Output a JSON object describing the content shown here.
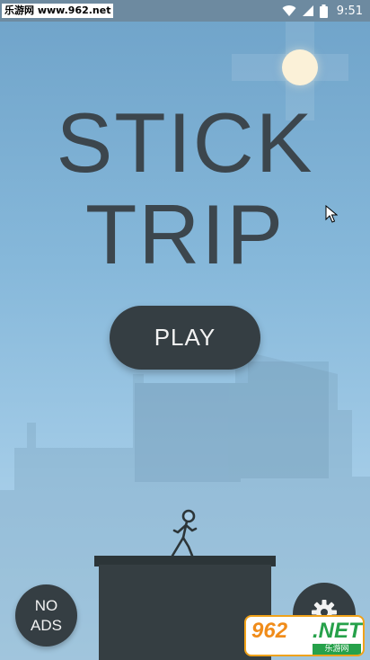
{
  "status_bar": {
    "watermark_text": "乐游网 www.962.net",
    "time": "9:51",
    "icons": [
      "wifi-icon",
      "signal-icon",
      "battery-icon"
    ]
  },
  "game": {
    "title_line1": "STICK",
    "title_line2": "TRIP",
    "play_label": "PLAY",
    "no_ads_line1": "NO",
    "no_ads_line2": "ADS",
    "settings_icon": "gear-icon"
  },
  "watermark_logo": {
    "digits": "962",
    "suffix": ".NET",
    "sub": "乐游网"
  },
  "colors": {
    "sky_top": "#6fa3c9",
    "sky_bottom": "#b6d9ef",
    "dark": "#353e43",
    "title": "#3c464d",
    "sun": "#fbf1d8"
  }
}
